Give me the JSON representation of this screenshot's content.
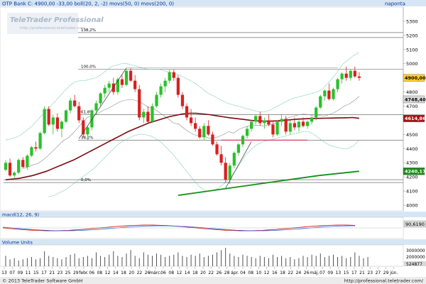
{
  "app": {
    "title_bar": "OTP Bank C: 4900,00 -33,00 boll(20, 2, -2) movs(50, 0) movs(200, 0)",
    "period_label": "naponta",
    "watermark_brand": "TeleTrader Professional",
    "watermark_url": "http://professional.teletrader.com",
    "macd_label": "macd(12, 26, 9)",
    "volume_label": "Volume Units",
    "copyright": "© 2013 TeleTrader Software GmbH",
    "footer_url": "http://professional.teletrader.com/"
  },
  "colors": {
    "background": "#ffffff",
    "header_bar": "#d7e6f4",
    "header_text": "#003399",
    "bollinger": "#68c6a4",
    "ma50": "#7a0a10",
    "ma200": "#13901a",
    "candle_up": "#2bc02b",
    "candle_down": "#d82020",
    "volume": "#404040",
    "support_line": "#d04060",
    "last_price_box": "#ffcc33",
    "ma50_box": "#a41414",
    "ma200_box": "#1a8a1a",
    "bb_box": "#d8d8d8"
  },
  "chart_data": [
    {
      "type": "candlestick",
      "title": "OTP Bank",
      "yticks": [
        4000,
        4100,
        4200,
        4300,
        4400,
        4500,
        4600,
        4700,
        4800,
        4900,
        5000,
        5100,
        5200,
        5300
      ],
      "ylim": [
        3960,
        5400
      ],
      "price_tags": [
        {
          "label": "4900,00",
          "value": 4900,
          "kind": "last"
        },
        {
          "label": "4748,40",
          "value": 4748,
          "kind": "bb"
        },
        {
          "label": "4614,86",
          "value": 4614,
          "kind": "ma50"
        },
        {
          "label": "4240,17",
          "value": 4240,
          "kind": "ma200"
        }
      ],
      "fib_levels": [
        {
          "label": "138,2%",
          "value": 5220
        },
        {
          "label": "100,0%",
          "value": 4960
        },
        {
          "label": "61,8%",
          "value": 4640
        },
        {
          "label": "38,2%",
          "value": 4460
        },
        {
          "label": "0,0%",
          "value": 4160
        }
      ],
      "x_axis_labels": [
        "13",
        "07",
        "09",
        "11",
        "15",
        "17",
        "21",
        "23",
        "25",
        "29",
        "febr.",
        "06",
        "08",
        "12",
        "14",
        "18",
        "20",
        "22",
        "26",
        "márc.",
        "06",
        "08",
        "12",
        "14",
        "18",
        "20",
        "22",
        "26",
        "28",
        "ápr.",
        "04",
        "08",
        "10",
        "12",
        "16",
        "18",
        "22",
        "24",
        "26",
        "máj.",
        "07",
        "09",
        "13",
        "15",
        "17",
        "21",
        "23",
        "27",
        "29",
        "jún."
      ],
      "ohlc": [
        [
          4250,
          4320,
          4240,
          4300
        ],
        [
          4300,
          4330,
          4200,
          4210
        ],
        [
          4210,
          4240,
          4180,
          4230
        ],
        [
          4230,
          4330,
          4220,
          4320
        ],
        [
          4320,
          4340,
          4260,
          4270
        ],
        [
          4270,
          4360,
          4250,
          4350
        ],
        [
          4350,
          4420,
          4340,
          4410
        ],
        [
          4410,
          4450,
          4380,
          4400
        ],
        [
          4400,
          4520,
          4390,
          4510
        ],
        [
          4510,
          4700,
          4500,
          4680
        ],
        [
          4680,
          4700,
          4560,
          4570
        ],
        [
          4570,
          4640,
          4500,
          4620
        ],
        [
          4620,
          4650,
          4520,
          4540
        ],
        [
          4540,
          4600,
          4480,
          4590
        ],
        [
          4590,
          4680,
          4580,
          4670
        ],
        [
          4670,
          4760,
          4650,
          4740
        ],
        [
          4740,
          4780,
          4690,
          4700
        ],
        [
          4700,
          4730,
          4580,
          4600
        ],
        [
          4600,
          4620,
          4480,
          4500
        ],
        [
          4500,
          4560,
          4460,
          4550
        ],
        [
          4550,
          4680,
          4530,
          4670
        ],
        [
          4670,
          4740,
          4640,
          4720
        ],
        [
          4720,
          4800,
          4700,
          4790
        ],
        [
          4790,
          4850,
          4760,
          4830
        ],
        [
          4830,
          4880,
          4800,
          4860
        ],
        [
          4860,
          4900,
          4780,
          4800
        ],
        [
          4800,
          4900,
          4780,
          4890
        ],
        [
          4890,
          4920,
          4830,
          4850
        ],
        [
          4850,
          4960,
          4840,
          4950
        ],
        [
          4950,
          4970,
          4870,
          4880
        ],
        [
          4880,
          4920,
          4800,
          4820
        ],
        [
          4820,
          4850,
          4600,
          4620
        ],
        [
          4620,
          4680,
          4580,
          4660
        ],
        [
          4660,
          4700,
          4580,
          4590
        ],
        [
          4590,
          4720,
          4580,
          4700
        ],
        [
          4700,
          4800,
          4690,
          4780
        ],
        [
          4780,
          4860,
          4760,
          4840
        ],
        [
          4840,
          4900,
          4800,
          4880
        ],
        [
          4880,
          4960,
          4860,
          4940
        ],
        [
          4940,
          4960,
          4880,
          4900
        ],
        [
          4900,
          4920,
          4760,
          4780
        ],
        [
          4780,
          4800,
          4680,
          4700
        ],
        [
          4700,
          4720,
          4600,
          4620
        ],
        [
          4620,
          4680,
          4560,
          4580
        ],
        [
          4580,
          4620,
          4520,
          4540
        ],
        [
          4540,
          4560,
          4470,
          4480
        ],
        [
          4480,
          4580,
          4460,
          4560
        ],
        [
          4560,
          4600,
          4490,
          4500
        ],
        [
          4500,
          4520,
          4420,
          4430
        ],
        [
          4430,
          4450,
          4350,
          4360
        ],
        [
          4360,
          4420,
          4280,
          4300
        ],
        [
          4300,
          4340,
          4160,
          4180
        ],
        [
          4180,
          4300,
          4150,
          4280
        ],
        [
          4280,
          4380,
          4260,
          4370
        ],
        [
          4370,
          4440,
          4350,
          4430
        ],
        [
          4430,
          4500,
          4410,
          4490
        ],
        [
          4490,
          4560,
          4470,
          4540
        ],
        [
          4540,
          4600,
          4520,
          4590
        ],
        [
          4590,
          4640,
          4570,
          4630
        ],
        [
          4630,
          4660,
          4560,
          4580
        ],
        [
          4580,
          4620,
          4540,
          4600
        ],
        [
          4600,
          4640,
          4560,
          4570
        ],
        [
          4570,
          4600,
          4480,
          4500
        ],
        [
          4500,
          4600,
          4490,
          4590
        ],
        [
          4590,
          4640,
          4560,
          4610
        ],
        [
          4610,
          4630,
          4500,
          4520
        ],
        [
          4520,
          4600,
          4500,
          4580
        ],
        [
          4580,
          4620,
          4530,
          4550
        ],
        [
          4550,
          4600,
          4520,
          4590
        ],
        [
          4590,
          4620,
          4550,
          4560
        ],
        [
          4560,
          4600,
          4540,
          4590
        ],
        [
          4590,
          4630,
          4570,
          4620
        ],
        [
          4620,
          4700,
          4600,
          4690
        ],
        [
          4690,
          4780,
          4680,
          4770
        ],
        [
          4770,
          4820,
          4740,
          4810
        ],
        [
          4810,
          4860,
          4740,
          4750
        ],
        [
          4750,
          4830,
          4740,
          4820
        ],
        [
          4820,
          4900,
          4800,
          4890
        ],
        [
          4890,
          4940,
          4860,
          4930
        ],
        [
          4930,
          4980,
          4880,
          4900
        ],
        [
          4900,
          4960,
          4880,
          4950
        ],
        [
          4950,
          4980,
          4900,
          4910
        ],
        [
          4910,
          4940,
          4880,
          4900
        ]
      ],
      "bollinger_upper": [
        4460,
        4470,
        4480,
        4500,
        4530,
        4560,
        4600,
        4640,
        4680,
        4720,
        4760,
        4800,
        4840,
        4870,
        4880,
        4880,
        4890,
        4900,
        4920,
        4950,
        4980,
        4990,
        5000,
        5000,
        4990,
        4980,
        4970,
        4960,
        4960,
        4960,
        4950,
        4940,
        4930,
        4920,
        4900,
        4880,
        4860,
        4830,
        4800,
        4780,
        4760,
        4740,
        4720,
        4710,
        4700,
        4690,
        4680,
        4670,
        4660,
        4660,
        4670,
        4690,
        4710,
        4730,
        4750,
        4760,
        4770,
        4780,
        4790,
        4800,
        4820,
        4860,
        4900,
        4950,
        5000,
        5030,
        5060,
        5080
      ],
      "bollinger_lower": [
        4060,
        4070,
        4090,
        4110,
        4140,
        4170,
        4200,
        4230,
        4260,
        4300,
        4340,
        4380,
        4420,
        4450,
        4470,
        4490,
        4500,
        4500,
        4490,
        4470,
        4440,
        4400,
        4360,
        4310,
        4260,
        4210,
        4160,
        4120,
        4100,
        4100,
        4120,
        4150,
        4190,
        4240,
        4300,
        4360,
        4400,
        4430,
        4450,
        4460,
        4470,
        4480,
        4490,
        4500,
        4510,
        4520,
        4520,
        4500,
        4470,
        4440,
        4420,
        4410,
        4400,
        4400,
        4420,
        4460
      ],
      "ma50": [
        4180,
        4185,
        4190,
        4200,
        4210,
        4225,
        4240,
        4260,
        4280,
        4300,
        4320,
        4345,
        4370,
        4395,
        4420,
        4445,
        4470,
        4495,
        4520,
        4540,
        4560,
        4580,
        4595,
        4610,
        4625,
        4635,
        4645,
        4650,
        4650,
        4645,
        4640,
        4632,
        4625,
        4618,
        4612,
        4606,
        4600,
        4596,
        4594,
        4594,
        4596,
        4600,
        4604,
        4608,
        4611,
        4613,
        4614,
        4615,
        4616,
        4617,
        4618,
        4620,
        4614
      ],
      "ma200": [
        4070,
        4090,
        4110,
        4130,
        4150,
        4170,
        4190,
        4210,
        4225,
        4240
      ],
      "support_line": {
        "from": 4460,
        "to": 4460
      },
      "macd_label_value": "90,6190",
      "volume_ticks": [
        "3000000",
        "2000000",
        "524877"
      ],
      "volume": [
        9,
        6,
        7,
        5,
        6,
        7,
        8,
        6,
        7,
        13,
        9,
        8,
        7,
        6,
        8,
        10,
        11,
        7,
        8,
        9,
        7,
        12,
        9,
        8,
        10,
        13,
        9,
        8,
        11,
        14,
        9,
        7,
        12,
        10,
        9,
        11,
        10,
        8,
        9,
        10,
        12,
        9,
        8,
        10,
        9,
        11,
        8,
        9,
        10,
        12,
        14,
        16,
        11,
        9,
        8,
        10,
        9,
        8,
        7,
        9,
        8,
        7,
        10,
        8,
        9,
        7,
        8,
        6,
        7,
        9,
        8,
        10,
        9,
        11,
        8,
        9,
        10,
        8,
        9,
        7,
        8,
        12,
        9,
        7,
        8
      ]
    }
  ]
}
